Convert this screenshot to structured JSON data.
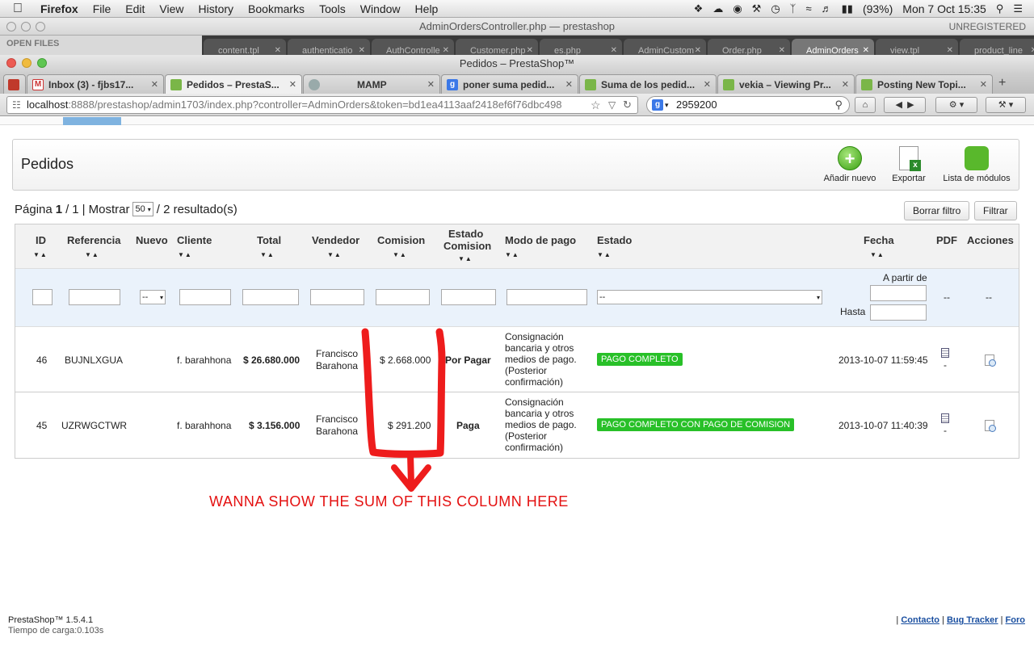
{
  "menubar": {
    "app": "Firefox",
    "items": [
      "File",
      "Edit",
      "View",
      "History",
      "Bookmarks",
      "Tools",
      "Window",
      "Help"
    ],
    "battery": "(93%)",
    "clock": "Mon 7 Oct  15:35"
  },
  "editor": {
    "title": "AdminOrdersController.php — prestashop",
    "status": "UNREGISTERED",
    "open_files": "OPEN FILES",
    "tabs": [
      "content.tpl",
      "authenticatio",
      "AuthControlle",
      "Customer.php",
      "es.php",
      "AdminCustom",
      "Order.php",
      "AdminOrders",
      "view.tpl",
      "product_line"
    ]
  },
  "browser": {
    "title": "Pedidos – PrestaShop™",
    "tabs": [
      {
        "label": "Inbox (3) - fjbs17...",
        "icon": "gmail-icon"
      },
      {
        "label": "Pedidos – PrestaS...",
        "icon": "prestashop-icon"
      },
      {
        "label": "MAMP",
        "icon": "globe-icon"
      },
      {
        "label": "poner suma pedid...",
        "icon": "google-icon"
      },
      {
        "label": "Suma de los pedid...",
        "icon": "prestashop-icon"
      },
      {
        "label": "vekia – Viewing Pr...",
        "icon": "prestashop-icon"
      },
      {
        "label": "Posting New Topi...",
        "icon": "prestashop-icon"
      }
    ],
    "url_host": "localhost",
    "url_rest": ":8888/prestashop/admin1703/index.php?controller=AdminOrders&token=bd1ea4113aaf2418ef6f76dbc498",
    "search_value": "2959200"
  },
  "page": {
    "title": "Pedidos",
    "toolbar": {
      "add": "Añadir nuevo",
      "export": "Exportar",
      "modules": "Lista de módulos"
    },
    "pager": {
      "pagina": "Página",
      "current": "1",
      "sep": "/",
      "total": "1",
      "mostrar": "| Mostrar",
      "per_page": "50",
      "results": "/ 2 resultado(s)"
    },
    "buttons": {
      "reset": "Borrar filtro",
      "filter": "Filtrar"
    },
    "columns": {
      "id": "ID",
      "ref": "Referencia",
      "nuevo": "Nuevo",
      "cliente": "Cliente",
      "total": "Total",
      "vendedor": "Vendedor",
      "comision": "Comision",
      "estado_comision_1": "Estado",
      "estado_comision_2": "Comision",
      "modo_pago": "Modo de pago",
      "estado": "Estado",
      "fecha": "Fecha",
      "pdf": "PDF",
      "acciones": "Acciones"
    },
    "filters": {
      "nuevo_select": "--",
      "estado_select": "--",
      "desde": "A partir de",
      "hasta": "Hasta",
      "pdf_dash": "--",
      "acciones_dash": "--"
    },
    "rows": [
      {
        "id": "46",
        "ref": "BUJNLXGUA",
        "cliente": "f. barahhona",
        "total": "$ 26.680.000",
        "vendedor_1": "Francisco",
        "vendedor_2": "Barahona",
        "comision": "$ 2.668.000",
        "estado_comision": "Por Pagar",
        "pago_1": "Consignación",
        "pago_2": "bancaria y otros",
        "pago_3": "medios de pago.",
        "pago_4": "(Posterior",
        "pago_5": "confirmación)",
        "estado": "PAGO COMPLETO",
        "fecha": "2013-10-07 11:59:45",
        "pdf_dash": "-"
      },
      {
        "id": "45",
        "ref": "UZRWGCTWR",
        "cliente": "f. barahhona",
        "total": "$ 3.156.000",
        "vendedor_1": "Francisco",
        "vendedor_2": "Barahona",
        "comision": "$ 291.200",
        "estado_comision": "Paga",
        "pago_1": "Consignación",
        "pago_2": "bancaria y otros",
        "pago_3": "medios de pago.",
        "pago_4": "(Posterior",
        "pago_5": "confirmación)",
        "estado": "PAGO COMPLETO CON PAGO DE COMISION",
        "fecha": "2013-10-07 11:40:39",
        "pdf_dash": "-"
      }
    ],
    "annotation": "WANNA SHOW THE SUM OF THIS COLUMN  HERE",
    "footer": {
      "version": "PrestaShop™ 1.5.4.1",
      "load_time": "Tiempo de carga:0.103s",
      "links": [
        "Contacto",
        "Bug Tracker",
        "Foro"
      ],
      "sep": "|"
    }
  },
  "colors": {
    "badge_green": "#28c028",
    "annotation_red": "#e41010",
    "link_blue": "#1a4fa0"
  }
}
